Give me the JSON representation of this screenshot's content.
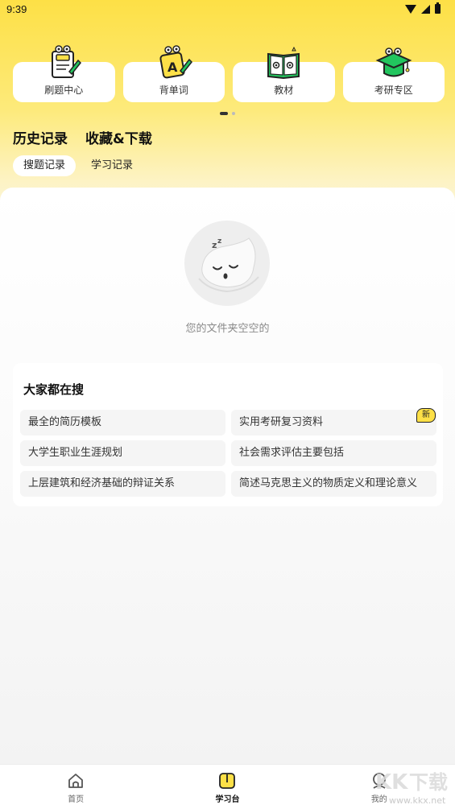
{
  "status_bar": {
    "time": "9:39"
  },
  "quick_cards": [
    {
      "label": "刷题中心",
      "icon": "quiz-notepad-icon"
    },
    {
      "label": "背单词",
      "icon": "vocabulary-card-icon"
    },
    {
      "label": "教材",
      "icon": "textbook-icon"
    },
    {
      "label": "考研专区",
      "icon": "graduation-cap-icon"
    }
  ],
  "main_tabs": [
    {
      "label": "历史记录",
      "active": true
    },
    {
      "label": "收藏&下载",
      "active": false
    }
  ],
  "sub_tabs": [
    {
      "label": "搜题记录",
      "active": true
    },
    {
      "label": "学习记录",
      "active": false
    }
  ],
  "empty_state": {
    "text": "您的文件夹空空的",
    "icon": "sleeping-mascot-icon"
  },
  "hot_search": {
    "title": "大家都在搜",
    "badge": "新",
    "items": [
      "最全的简历模板",
      "实用考研复习资料",
      "大学生职业生涯规划",
      "社会需求评估主要包括",
      "上层建筑和经济基础的辩证关系",
      "简述马克思主义的物质定义和理论意义"
    ]
  },
  "bottom_nav": [
    {
      "label": "首页",
      "icon": "home-icon",
      "active": false
    },
    {
      "label": "学习台",
      "icon": "study-book-icon",
      "active": true
    },
    {
      "label": "我的",
      "icon": "profile-icon",
      "active": false
    }
  ],
  "watermark": {
    "text": "www.kkx.net"
  },
  "colors": {
    "accent_yellow": "#fde046",
    "accent_green": "#22c55e"
  }
}
